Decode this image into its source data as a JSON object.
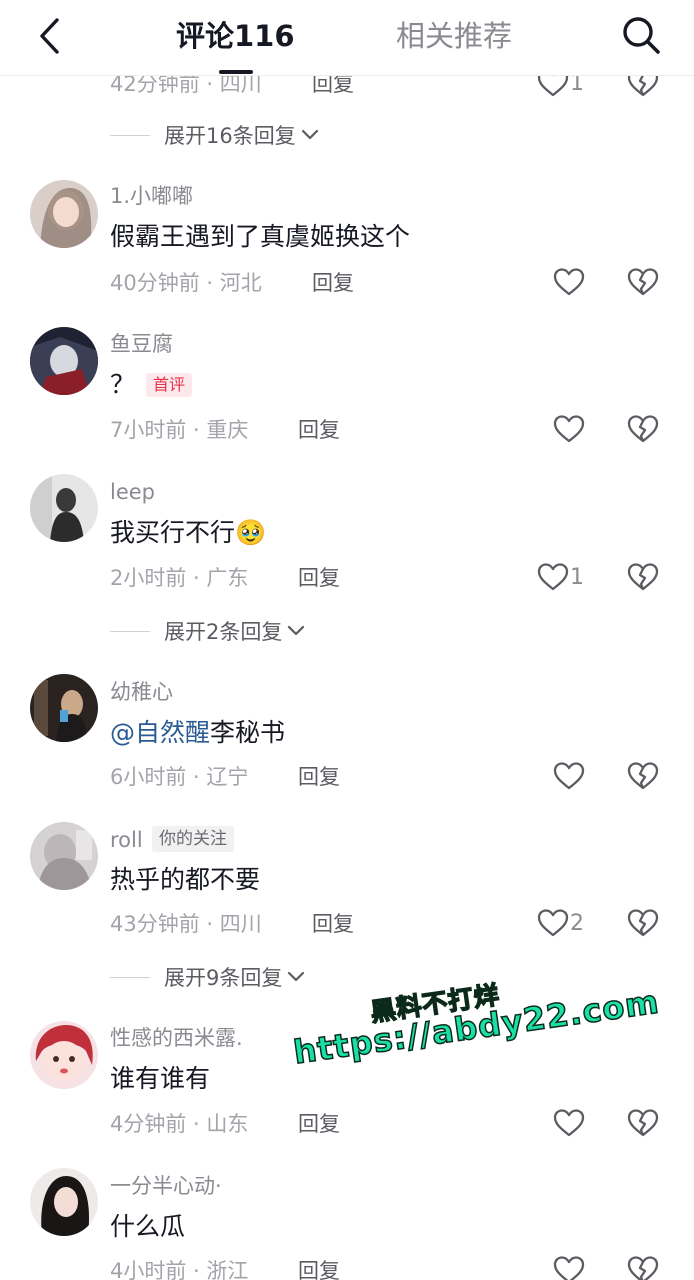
{
  "header": {
    "back_icon": "back-chevron-icon",
    "tab_comments": "评论116",
    "tab_related": "相关推荐",
    "search_icon": "search-icon"
  },
  "partial_top": {
    "time": "42分钟前",
    "location": "四川",
    "reply": "回复",
    "likes": "1",
    "expand": "展开16条回复"
  },
  "comments": [
    {
      "name": "1.小嘟嘟",
      "text": "假霸王遇到了真虞姬换这个",
      "time": "40分钟前",
      "location": "河北",
      "reply": "回复"
    },
    {
      "name": "鱼豆腐",
      "text": "？",
      "tag": "首评",
      "time": "7小时前",
      "location": "重庆",
      "reply": "回复"
    },
    {
      "name": "leep",
      "text": "我买行不行",
      "emoji": "🥹",
      "time": "2小时前",
      "location": "广东",
      "reply": "回复",
      "likes": "1",
      "expand": "展开2条回复"
    },
    {
      "name": "幼稚心",
      "mention": "@自然醒",
      "text": "李秘书",
      "time": "6小时前",
      "location": "辽宁",
      "reply": "回复"
    },
    {
      "name": "roll",
      "follow_tag": "你的关注",
      "text": "热乎的都不要",
      "time": "43分钟前",
      "location": "四川",
      "reply": "回复",
      "likes": "2",
      "expand": "展开9条回复"
    },
    {
      "name": "性感的西米露.",
      "text": "谁有谁有",
      "time": "4分钟前",
      "location": "山东",
      "reply": "回复"
    },
    {
      "name": "一分半心动·",
      "text": "什么瓜",
      "time": "4小时前",
      "location": "浙江",
      "reply": "回复"
    }
  ],
  "separator": " · ",
  "watermark": {
    "line1": "黑料不打烊",
    "line2": "https://abdy22.com"
  },
  "colors": {
    "accent_mention": "#2b5b95",
    "first_tag": "#e8344a",
    "watermark": "#18e0a6"
  }
}
